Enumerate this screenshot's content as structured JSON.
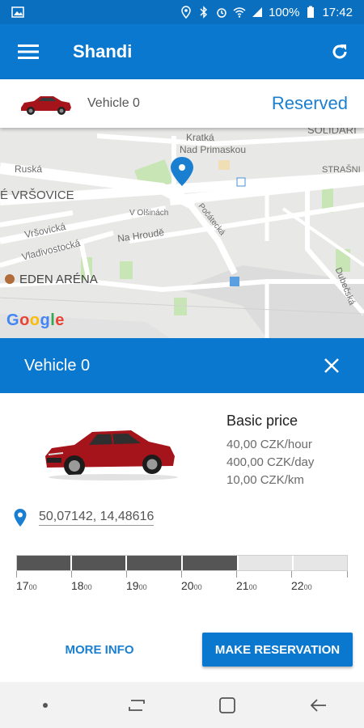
{
  "status_bar": {
    "battery": "100%",
    "time": "17:42"
  },
  "app_bar": {
    "title": "Shandi"
  },
  "reservation_card": {
    "vehicle_name": "Vehicle 0",
    "status": "Reserved"
  },
  "map": {
    "labels": {
      "kratka": "Kratká",
      "nad_primaskou": "Nad Primaskou",
      "solidarita": "SOLIDARI",
      "strasnice": "STRAŠNI",
      "ruska": "Ruská",
      "vrsovice": "É VRŠOVICE",
      "vrsovicka": "Vršovická",
      "vladivostocka": "Vladivostocká",
      "v_olsinach": "V Olšinách",
      "na_hroude": "Na Hroudě",
      "pocatecka": "Počátecká",
      "eden_arena": "EDEN ARÉNA",
      "dubecska": "Dubečská"
    },
    "google": "Google"
  },
  "sheet": {
    "title": "Vehicle 0",
    "price_title": "Basic price",
    "prices": [
      "40,00 CZK/hour",
      "400,00 CZK/day",
      "10,00 CZK/km"
    ],
    "coordinates": "50,07142, 14,48616",
    "timeline": {
      "segments": [
        "booked",
        "booked",
        "booked",
        "booked",
        "free",
        "free"
      ],
      "hours": [
        {
          "h": "17",
          "m": "00"
        },
        {
          "h": "18",
          "m": "00"
        },
        {
          "h": "19",
          "m": "00"
        },
        {
          "h": "20",
          "m": "00"
        },
        {
          "h": "21",
          "m": "00"
        },
        {
          "h": "22",
          "m": "00"
        }
      ]
    },
    "more_info_label": "MORE INFO",
    "reserve_label": "MAKE RESERVATION"
  },
  "colors": {
    "primary": "#0a78cf",
    "status_bar": "#0a6fbe",
    "accent_text": "#1a7fd0",
    "booked": "#555555",
    "free": "#e6e6e6",
    "car_red": "#a5141a"
  },
  "icons": {
    "menu": "hamburger-menu-icon",
    "refresh": "refresh-icon",
    "close": "close-icon",
    "location": "location-pin-icon"
  }
}
